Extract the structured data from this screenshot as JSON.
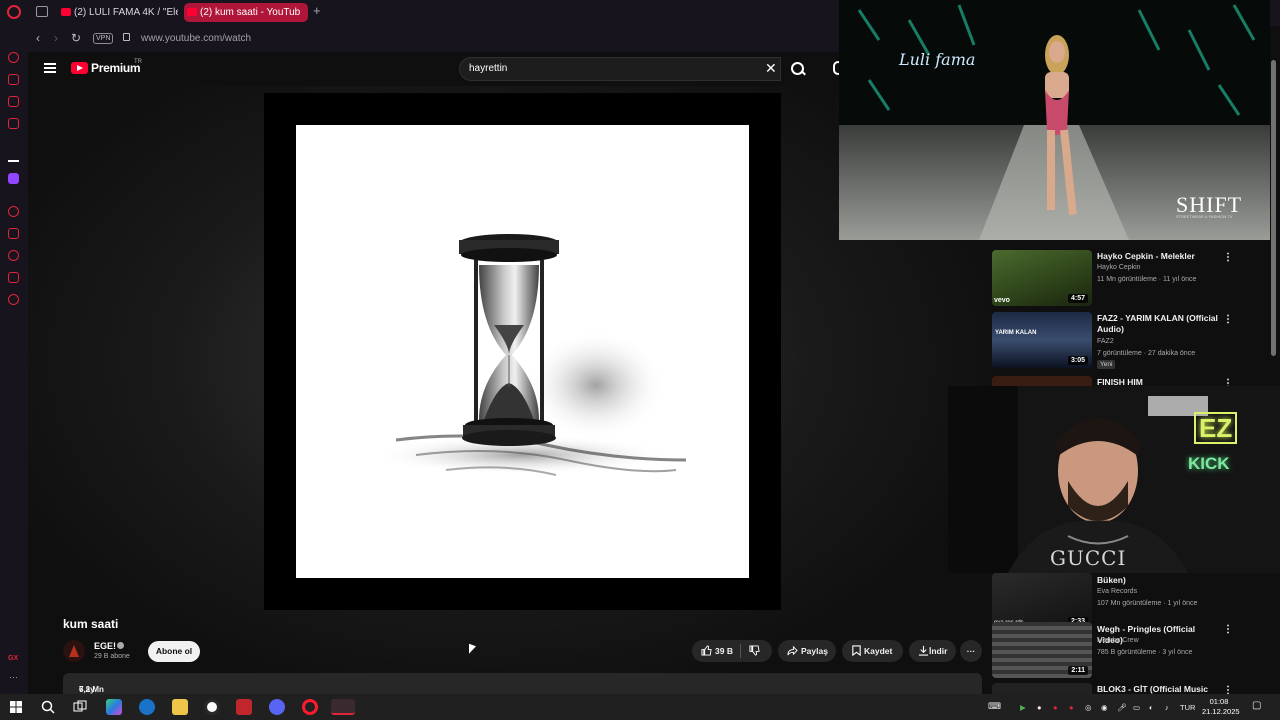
{
  "browser": {
    "tabs": [
      {
        "label": "(2) LULI FAMA 4K / \"Elect",
        "active": false
      },
      {
        "label": "(2) kum saati - YouTub",
        "active": true
      }
    ],
    "vpn_label": "VPN",
    "url": "www.youtube.com/watch"
  },
  "youtube": {
    "logo_text": "Premium",
    "region": "TR",
    "search_value": "hayrettin"
  },
  "video": {
    "title": "kum saati",
    "channel": "EGE!",
    "subscribers": "29 B abone",
    "subscribe_label": "Abone ol",
    "likes": "39 B",
    "share_label": "Paylaş",
    "save_label": "Kaydet",
    "download_label": "İndir",
    "views": "7,2 Mn görüntüleme",
    "published": "6 ay önce"
  },
  "recommendations": [
    {
      "title": "Hayko Cepkin - Melekler",
      "channel": "Hayko Cepkin",
      "views": "11 Mn görüntüleme",
      "age": "11 yıl önce",
      "duration": "4:57",
      "thumb_label": "vevo"
    },
    {
      "title": "FAZ2 - YARIM KALAN (Official Audio)",
      "channel": "FAZ2",
      "views": "7 görüntüleme",
      "age": "27 dakika önce",
      "duration": "3:05",
      "badge": "Yeni",
      "thumb_label": "YARIM KALAN"
    },
    {
      "title": "FINISH HIM"
    },
    {
      "title": "Büken)",
      "channel": "Eva Records",
      "views": "107 Mn görüntüleme",
      "age": "1 yıl önce",
      "duration": "2:33",
      "thumb_label": "eva rec rds"
    },
    {
      "title": "Wegh - Pringles (Official Video)",
      "channel": "Mamba Crew",
      "views": "785 B görüntüleme",
      "age": "3 yıl önce",
      "duration": "2:11"
    },
    {
      "title": "BLOK3 - GİT (Official Music"
    }
  ],
  "pip_fashion": {
    "brand": "Luli fama",
    "watermark": "SHIFT",
    "watermark_sub": "STREETWEAR & FASHION.TV"
  },
  "pip_streamer": {
    "neon_top": "EZ",
    "neon_bottom": "KICK",
    "shirt_text": "GUCCI"
  },
  "taskbar": {
    "lang": "TUR",
    "time": "01:08",
    "date": "21.12.2025"
  },
  "colors": {
    "accent_red": "#ff0033",
    "opera_red": "#e0243a",
    "tab_active": "#b0163a"
  }
}
